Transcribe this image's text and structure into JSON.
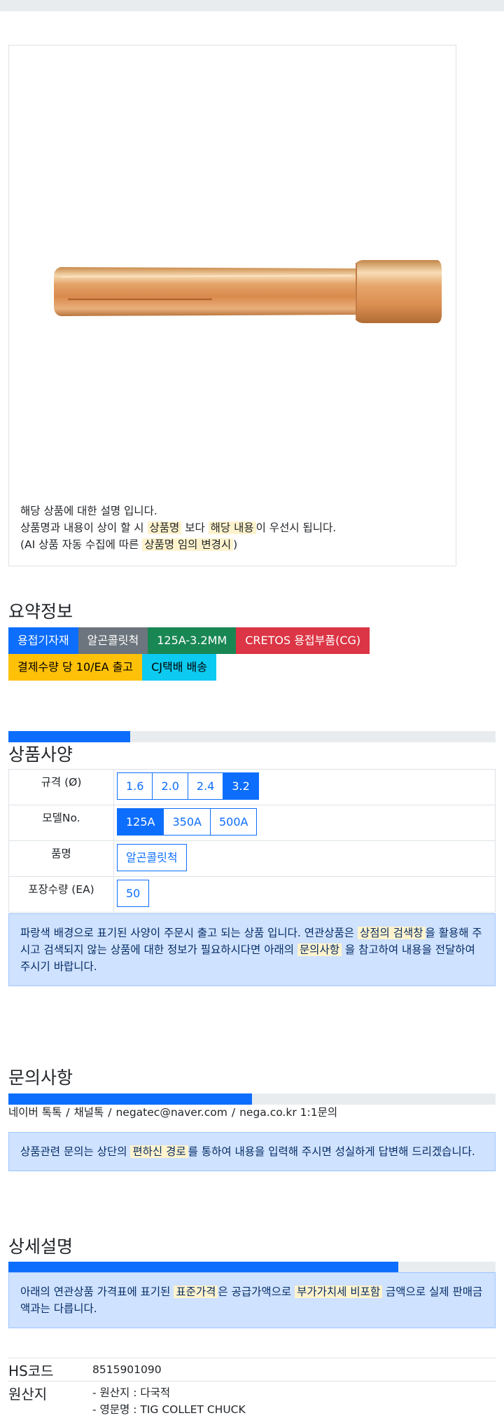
{
  "product": {
    "image_icon": "collet-chuck-image",
    "desc_lines": [
      {
        "a": "해당 상품에 대한 설명 입니다.",
        "h1": "",
        "b": "",
        "h2": "",
        "c": ""
      },
      {
        "a": "상품명과 내용이 상이 할 시 ",
        "h1": "상품명",
        "b": " 보다 ",
        "h2": "해당 내용",
        "c": "이 우선시 됩니다."
      },
      {
        "a": "(AI 상품 자동 수집에 따른 ",
        "h1": "상품명 임의 변경시",
        "b": ")",
        "h2": "",
        "c": ""
      }
    ]
  },
  "summary": {
    "title": "요약정보",
    "tags": [
      {
        "label": "용접기자재",
        "bg": "#0d6efd",
        "fg": "#ffffff"
      },
      {
        "label": "알곤콜릿척",
        "bg": "#6c757d",
        "fg": "#ffffff"
      },
      {
        "label": "125A-3.2MM",
        "bg": "#198754",
        "fg": "#ffffff"
      },
      {
        "label": "CRETOS 용접부품(CG)",
        "bg": "#dc3545",
        "fg": "#ffffff"
      },
      {
        "label": "결제수량 당 10/EA 출고",
        "bg": "#ffc107",
        "fg": "#000000"
      },
      {
        "label": "CJ택배 배송",
        "bg": "#0dcaf0",
        "fg": "#000000"
      }
    ]
  },
  "spec": {
    "title": "상품사양",
    "progress": 0.25,
    "rows": [
      {
        "label": "규격 (Ø)",
        "options": [
          "1.6",
          "2.0",
          "2.4",
          "3.2"
        ],
        "selected": 3
      },
      {
        "label": "모델No.",
        "options": [
          "125A",
          "350A",
          "500A"
        ],
        "selected": 0
      },
      {
        "label": "품명",
        "options": [
          "알곤콜릿척"
        ],
        "selected": -1
      },
      {
        "label": "포장수량 (EA)",
        "options": [
          "50"
        ],
        "selected": -1
      }
    ],
    "notice": {
      "a": "파랑색 배경으로 표기된 사양이 주문시 출고 되는 상품 입니다. 연관상품은 ",
      "h1": "상점의 검색창",
      "b": "을 활용해 주시고 검색되지 않는 상품에 대한 정보가 필요하시다면 아래의 ",
      "h2": "문의사항",
      "c": " 을 참고하여 내용을 전달하여 주시기 바랍니다."
    }
  },
  "inquiry": {
    "title": "문의사항",
    "progress": 0.5,
    "contacts": [
      "네이버 톡톡",
      "채널톡",
      "negatec@naver.com",
      "nega.co.kr 1:1문의"
    ],
    "separator": "/",
    "notice": {
      "a": "상품관련 문의는 상단의 ",
      "h1": "편하신 경로",
      "b": "를 통하여 내용을 입력해 주시면 성실하게 답변해 드리겠습니다."
    }
  },
  "detail": {
    "title": "상세설명",
    "progress": 0.8,
    "notice": {
      "a": "아래의 연관상품 가격표에 표기된 ",
      "h1": "표준가격",
      "b": "은 공급가액으로 ",
      "h2": "부가가치세 비포함",
      "c": " 금액으로 실제 판매금액과는 다릅니다."
    },
    "hs_label": "HS코드",
    "hs_value": "8515901090",
    "origin_label": "원산지",
    "origin_lines": [
      "- 원산지 : 다국적",
      "- 영문명 : TIG COLLET CHUCK"
    ]
  }
}
